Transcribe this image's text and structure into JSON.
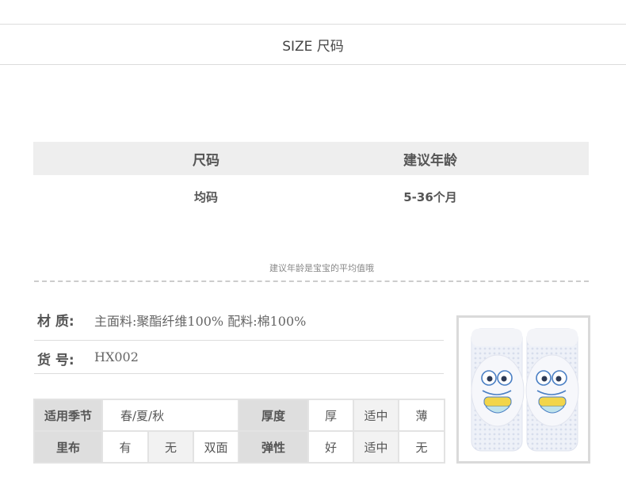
{
  "section": {
    "title": "SIZE 尺码"
  },
  "size_table": {
    "headers": [
      "尺码",
      "建议年龄"
    ],
    "row": [
      "均码",
      "5-36个月"
    ]
  },
  "note": "建议年龄是宝宝的平均值哦",
  "info": [
    {
      "label": "材 质:",
      "value": "主面料:聚酯纤维100% 配料:棉100%"
    },
    {
      "label": "货 号:",
      "value": "HX002"
    }
  ],
  "attributes": {
    "season_label": "适用季节",
    "season_value": "春/夏/秋",
    "thickness_label": "厚度",
    "thickness_options": [
      "厚",
      "适中",
      "薄"
    ],
    "lining_label": "里布",
    "lining_options": [
      "有",
      "无",
      "双面"
    ],
    "elasticity_label": "弹性",
    "elasticity_options": [
      "好",
      "适中",
      "无"
    ]
  },
  "product_image": {
    "description": "knee-pads-frog-icon",
    "colors": {
      "mesh": "#e8ecf6",
      "pad": "#f4f6fb",
      "frog_outline": "#4a7fc4",
      "frog_accent": "#f2d54a"
    }
  }
}
